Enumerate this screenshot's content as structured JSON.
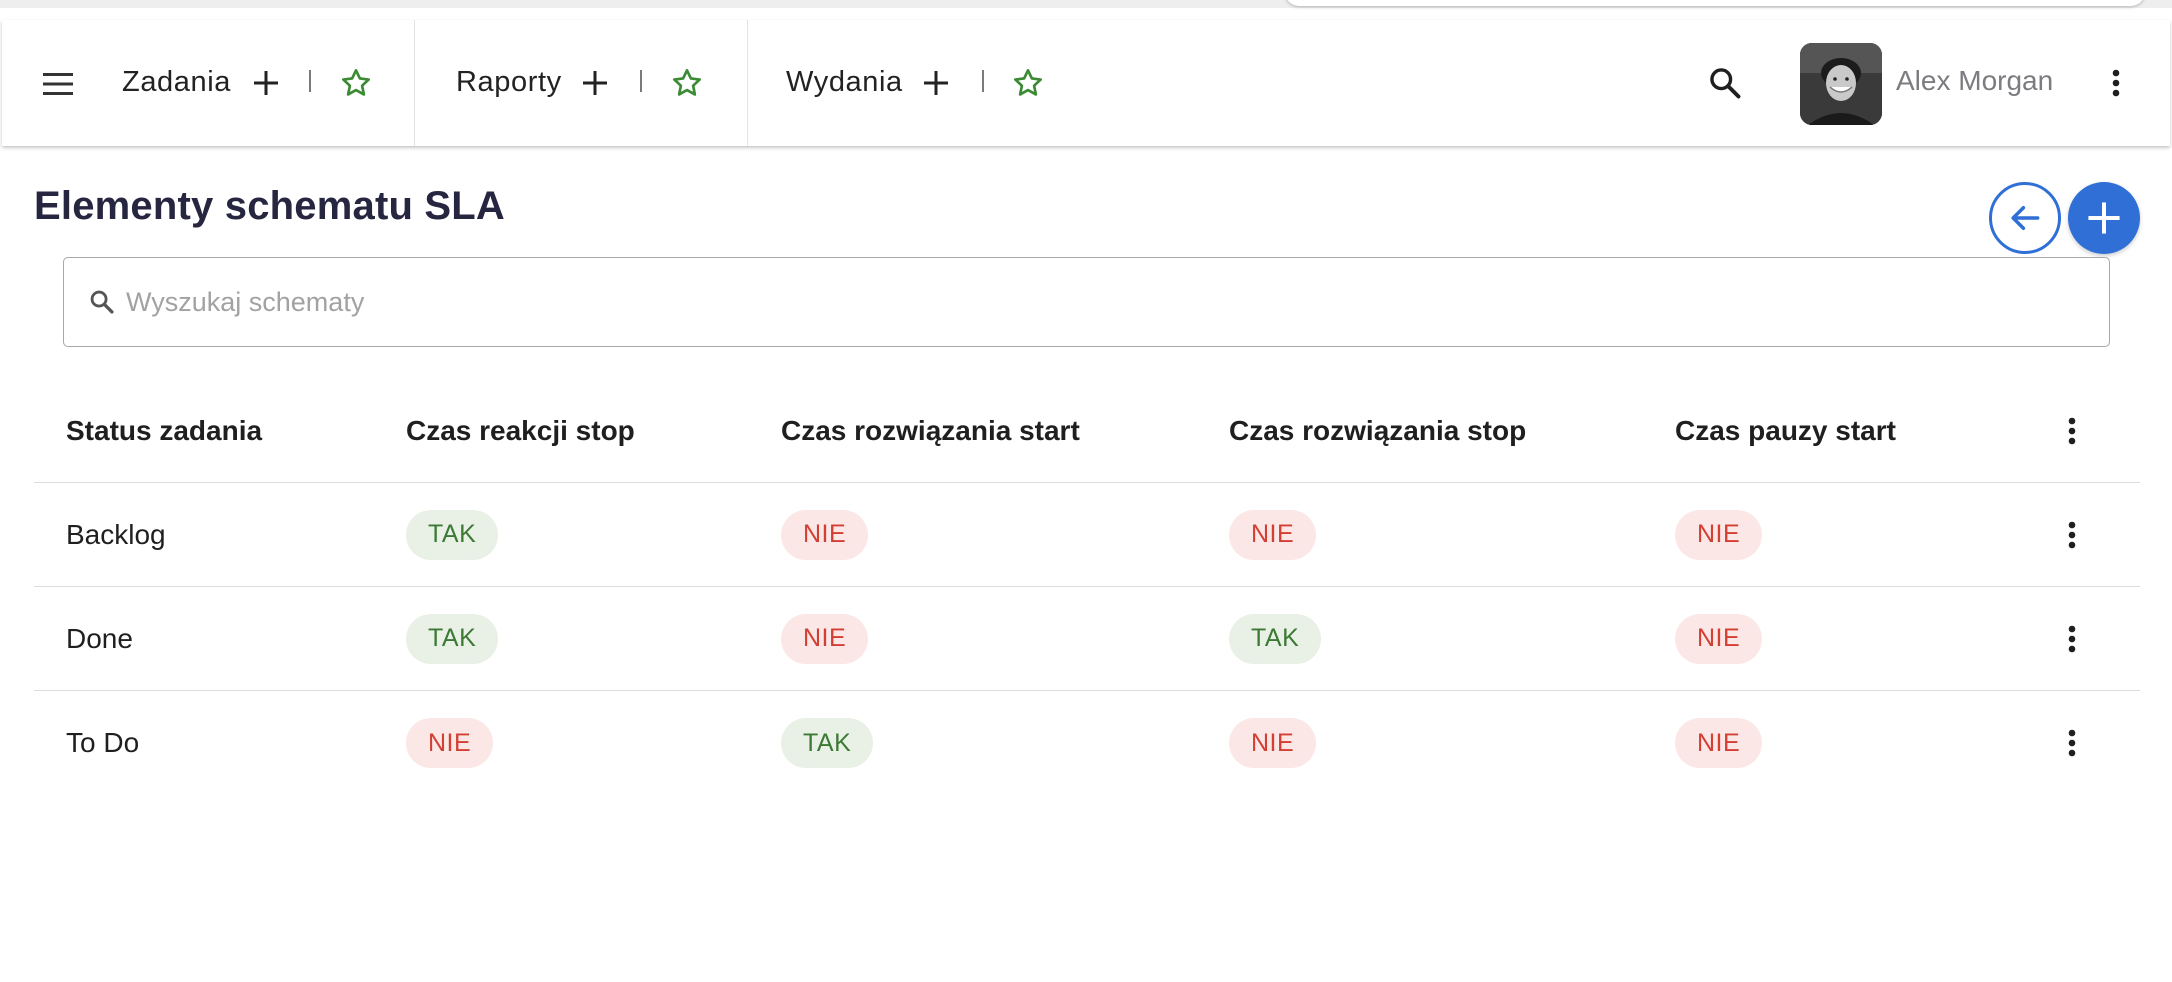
{
  "nav": {
    "tabs": [
      {
        "label": "Zadania"
      },
      {
        "label": "Raporty"
      },
      {
        "label": "Wydania"
      }
    ],
    "user_name": "Alex Morgan"
  },
  "page": {
    "title": "Elementy schematu SLA"
  },
  "search": {
    "placeholder": "Wyszukaj schematy",
    "value": ""
  },
  "table": {
    "headers": [
      "Status zadania",
      "Czas reakcji stop",
      "Czas rozwiązania start",
      "Czas rozwiązania stop",
      "Czas pauzy start"
    ],
    "rows": [
      {
        "status": "Backlog",
        "values": [
          "TAK",
          "NIE",
          "NIE",
          "NIE"
        ]
      },
      {
        "status": "Done",
        "values": [
          "TAK",
          "NIE",
          "TAK",
          "NIE"
        ]
      },
      {
        "status": "To Do",
        "values": [
          "NIE",
          "TAK",
          "NIE",
          "NIE"
        ]
      }
    ]
  },
  "colors": {
    "accent": "#2f6fd6",
    "star_green": "#3c8a34",
    "yes_bg": "#e9f0e6",
    "yes_text": "#3c7a34",
    "no_bg": "#fbe7e6",
    "no_text": "#d43f34"
  },
  "icons": {
    "menu": "menu-icon",
    "add": "plus-icon",
    "favorite": "star-outline-icon",
    "search": "search-icon",
    "more": "more-vertical-icon",
    "back": "arrow-left-icon"
  }
}
